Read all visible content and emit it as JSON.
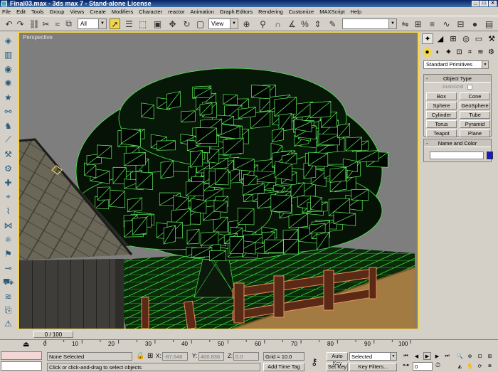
{
  "titlebar": {
    "title": "Final03.max - 3ds max 7 - Stand-alone License",
    "buttons": [
      "_",
      "□",
      "×"
    ]
  },
  "menu": [
    "File",
    "Edit",
    "Tools",
    "Group",
    "Views",
    "Create",
    "Modifiers",
    "Character",
    "reactor",
    "Animation",
    "Graph Editors",
    "Rendering",
    "Customize",
    "MAXScript",
    "Help"
  ],
  "toolbar": {
    "selection_filter": "All",
    "reference_coord": "View"
  },
  "viewport": {
    "label": "Perspective"
  },
  "command_panel": {
    "category": "Standard Primitives",
    "object_type": {
      "title": "Object Type",
      "autogrid": "AutoGrid",
      "buttons": [
        "Box",
        "Cone",
        "Sphere",
        "GeoSphere",
        "Cylinder",
        "Tube",
        "Torus",
        "Pyramid",
        "Teapot",
        "Plane"
      ]
    },
    "name_color": {
      "title": "Name and Color",
      "name_value": "",
      "color": "#1a1ac8"
    }
  },
  "time": {
    "slider_label": "0 / 100",
    "ticks": [
      "0",
      "10",
      "20",
      "30",
      "40",
      "50",
      "60",
      "70",
      "80",
      "90",
      "100"
    ]
  },
  "status": {
    "selection": "None Selected",
    "prompt": "Click or click-and-drag to select objects",
    "x_label": "X:",
    "x_value": "-87.646",
    "y_label": "Y:",
    "y_value": "400.836",
    "z_label": "Z:",
    "z_value": "0.0",
    "grid": "Grid = 10.0",
    "add_time_tag": "Add Time Tag",
    "auto_key": "Auto Key",
    "set_key": "Set Key",
    "key_mode": "Selected",
    "key_filters": "Key Filters...",
    "frame": "0"
  }
}
